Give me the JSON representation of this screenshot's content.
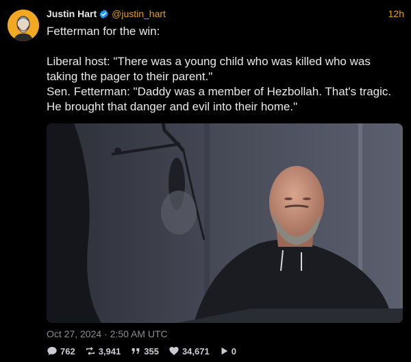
{
  "post": {
    "author_name": "Justin Hart",
    "handle": "@justin_hart",
    "relative_time": "12h",
    "text": "Fetterman for the win:\n\nLiberal host: \"There was a young child who was killed who was taking the pager to their parent.\"\nSen. Fetterman: \"Daddy was a member of Hezbollah. That's tragic. He brought that danger and evil into their home.\"",
    "timestamp": "Oct 27, 2024 · 2:50 AM UTC"
  },
  "stats": {
    "replies": "762",
    "reposts": "3,941",
    "quotes": "355",
    "likes": "34,671",
    "views": "0"
  },
  "icons": {
    "verified": "verified-badge-icon",
    "reply": "comment-icon",
    "repost": "repost-icon",
    "quote": "quote-icon",
    "like": "heart-icon",
    "views": "play-icon"
  },
  "colors": {
    "background": "#000000",
    "accent": "#e8a000",
    "verified": "#1d9bf0",
    "muted": "#8b8f96"
  }
}
